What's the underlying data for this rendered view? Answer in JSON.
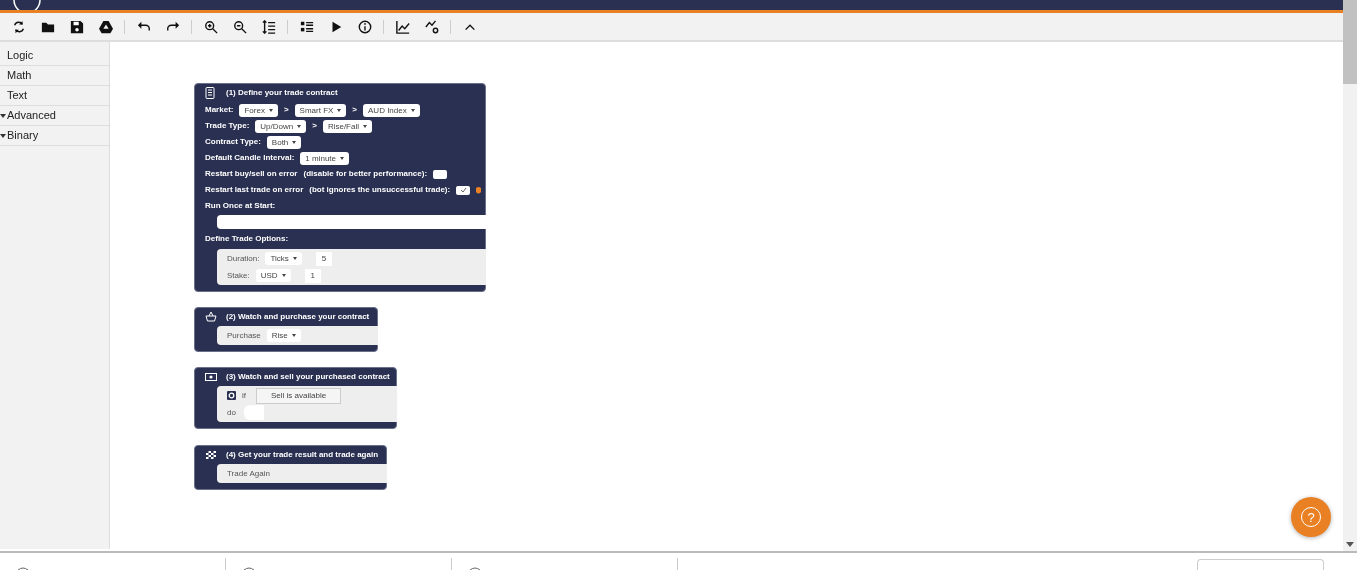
{
  "toolbar": [
    {
      "kind": "refresh"
    },
    {
      "kind": "folder"
    },
    {
      "kind": "save"
    },
    {
      "kind": "drive"
    },
    {
      "kind": "separator"
    },
    {
      "kind": "undo"
    },
    {
      "kind": "redo"
    },
    {
      "kind": "separator"
    },
    {
      "kind": "zoom-in"
    },
    {
      "kind": "zoom-out"
    },
    {
      "kind": "sort"
    },
    {
      "kind": "separator"
    },
    {
      "kind": "list"
    },
    {
      "kind": "play"
    },
    {
      "kind": "info"
    },
    {
      "kind": "separator"
    },
    {
      "kind": "chart"
    },
    {
      "kind": "flow"
    },
    {
      "kind": "separator"
    },
    {
      "kind": "collapse"
    }
  ],
  "sidebar": {
    "items": [
      {
        "label": "Logic",
        "has_children": false
      },
      {
        "label": "Math",
        "has_children": false
      },
      {
        "label": "Text",
        "has_children": false
      },
      {
        "label": "Advanced",
        "has_children": true
      },
      {
        "label": "Binary",
        "has_children": true
      }
    ]
  },
  "blocks": [
    {
      "title": "(1) Define your trade contract",
      "rows": [
        {
          "kind": "fields",
          "parts": [
            {
              "kind": "label",
              "text": "Market:"
            },
            {
              "kind": "dropdown",
              "text": "Forex"
            },
            {
              "kind": "label",
              "text": ">"
            },
            {
              "kind": "dropdown",
              "text": "Smart FX"
            },
            {
              "kind": "label",
              "text": ">"
            },
            {
              "kind": "dropdown",
              "text": "AUD Index"
            }
          ]
        },
        {
          "kind": "fields",
          "parts": [
            {
              "kind": "label",
              "text": "Trade Type:"
            },
            {
              "kind": "dropdown",
              "text": "Up/Down"
            },
            {
              "kind": "label",
              "text": ">"
            },
            {
              "kind": "dropdown",
              "text": "Rise/Fall"
            }
          ]
        },
        {
          "kind": "fields",
          "parts": [
            {
              "kind": "label",
              "text": "Contract Type:"
            },
            {
              "kind": "dropdown",
              "text": "Both"
            }
          ]
        },
        {
          "kind": "fields",
          "parts": [
            {
              "kind": "label",
              "text": "Default Candle Interval:"
            },
            {
              "kind": "dropdown",
              "text": "1 minute"
            }
          ]
        },
        {
          "kind": "fields",
          "parts": [
            {
              "kind": "label",
              "text": "Restart buy/sell on error"
            },
            {
              "kind": "label",
              "text": "(disable for better performance):"
            },
            {
              "kind": "checkbox",
              "checked": false
            }
          ]
        },
        {
          "kind": "fields",
          "parts": [
            {
              "kind": "label",
              "text": "Restart last trade on error"
            },
            {
              "kind": "label",
              "text": "(bot ignores the unsuccessful trade):"
            },
            {
              "kind": "checkbox",
              "checked": true
            },
            {
              "kind": "warning"
            }
          ]
        },
        {
          "kind": "fields",
          "parts": [
            {
              "kind": "label",
              "text": "Run Once at Start:"
            }
          ]
        },
        {
          "kind": "slot"
        },
        {
          "kind": "fields",
          "parts": [
            {
              "kind": "label",
              "text": "Define Trade Options:"
            }
          ]
        },
        {
          "kind": "subblock",
          "rows": [
            {
              "kind": "fields",
              "parts": [
                {
                  "kind": "sublabel",
                  "text": "Duration:"
                },
                {
                  "kind": "dropdown",
                  "text": "Ticks"
                },
                {
                  "kind": "number",
                  "text": "5"
                }
              ]
            },
            {
              "kind": "fields",
              "parts": [
                {
                  "kind": "sublabel",
                  "text": "Stake:"
                },
                {
                  "kind": "dropdown",
                  "text": "USD"
                },
                {
                  "kind": "number",
                  "text": "1"
                }
              ]
            }
          ]
        }
      ]
    },
    {
      "title": "(2) Watch and purchase your contract",
      "rows": [
        {
          "kind": "subblock",
          "rows": [
            {
              "kind": "fields",
              "parts": [
                {
                  "kind": "sublabel",
                  "text": "Purchase"
                },
                {
                  "kind": "dropdown",
                  "text": "Rise"
                }
              ]
            }
          ]
        }
      ]
    },
    {
      "title": "(3) Watch and sell your purchased contract",
      "rows": [
        {
          "kind": "subblock",
          "rows": [
            {
              "kind": "fields",
              "parts": [
                {
                  "kind": "gear"
                },
                {
                  "kind": "sublabel",
                  "text": "if"
                },
                {
                  "kind": "value",
                  "text": "Sell is available"
                }
              ]
            },
            {
              "kind": "fields",
              "parts": [
                {
                  "kind": "sublabel",
                  "text": "do"
                },
                {
                  "kind": "notch"
                }
              ]
            }
          ]
        }
      ]
    },
    {
      "title": "(4) Get your trade result and trade again",
      "rows": [
        {
          "kind": "subblock",
          "rows": [
            {
              "kind": "fields",
              "parts": [
                {
                  "kind": "sublabel",
                  "text": "Trade Again"
                }
              ]
            }
          ]
        }
      ]
    }
  ],
  "help_button": {
    "label": "?"
  }
}
